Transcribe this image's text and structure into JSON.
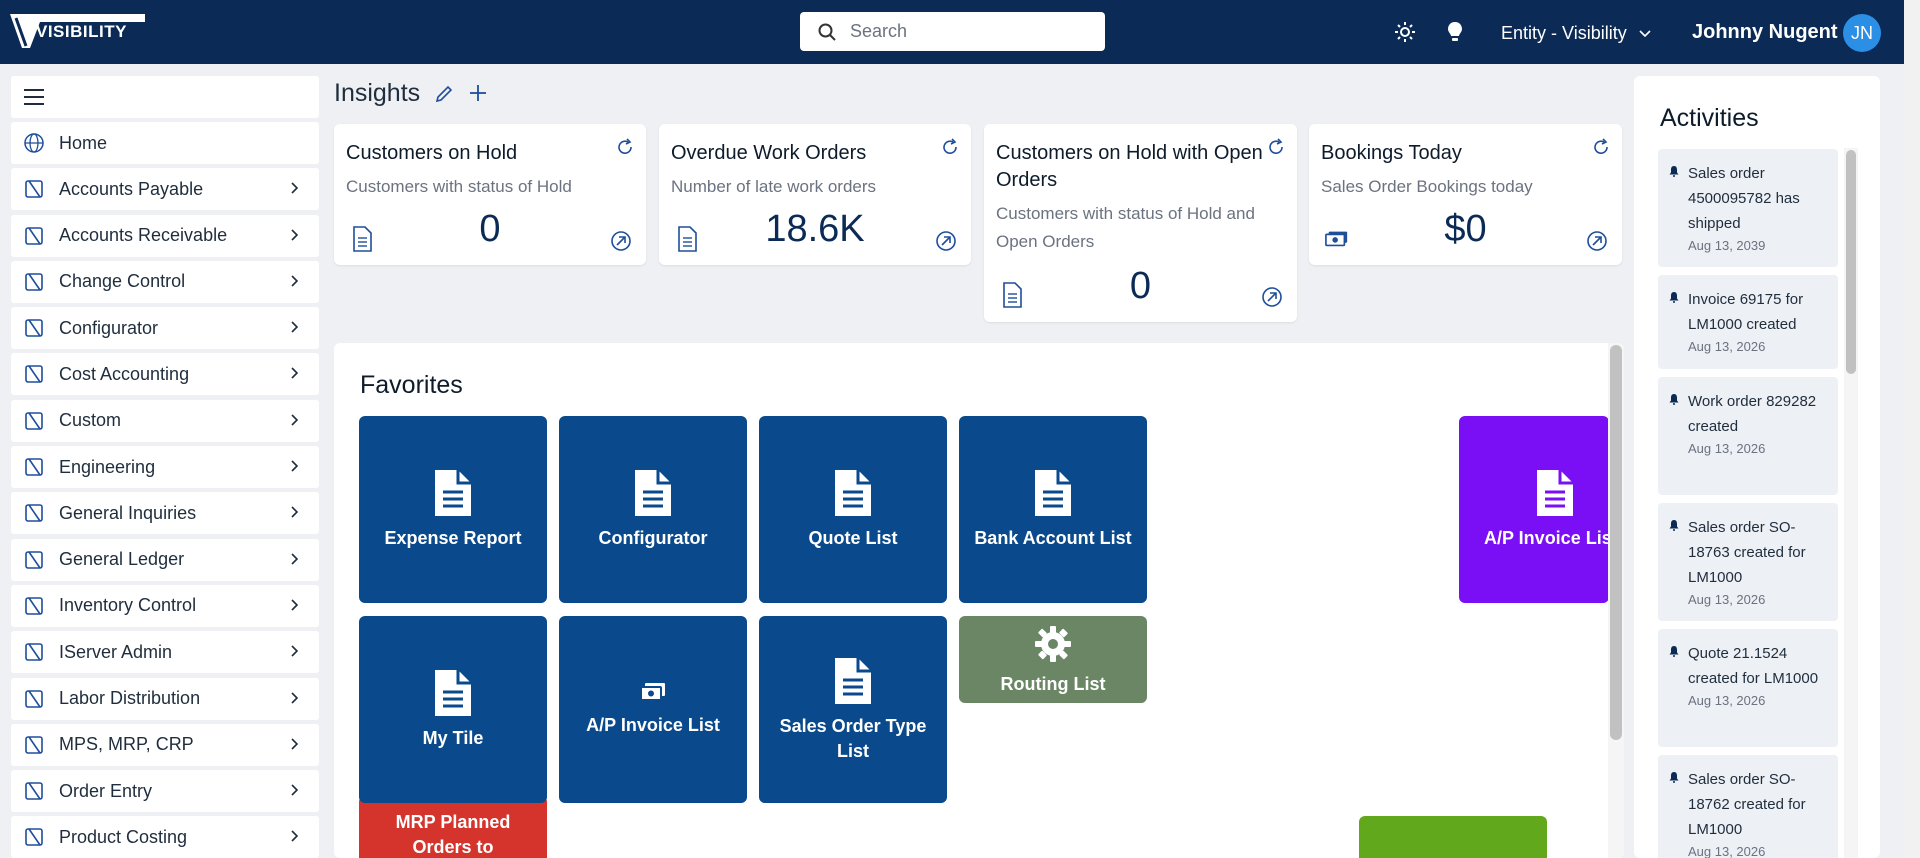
{
  "header": {
    "logo_text": "VISIBILITY",
    "search_placeholder": "Search",
    "entity_label": "Entity - Visibility",
    "user_name": "Johnny Nugent",
    "user_initials": "JN"
  },
  "sidebar": {
    "items": [
      {
        "label": "Home",
        "icon": "globe-icon"
      },
      {
        "label": "Accounts Payable",
        "icon": "module-icon"
      },
      {
        "label": "Accounts Receivable",
        "icon": "module-icon"
      },
      {
        "label": "Change Control",
        "icon": "module-icon"
      },
      {
        "label": "Configurator",
        "icon": "module-icon"
      },
      {
        "label": "Cost Accounting",
        "icon": "module-icon"
      },
      {
        "label": "Custom",
        "icon": "module-icon"
      },
      {
        "label": "Engineering",
        "icon": "module-icon"
      },
      {
        "label": "General Inquiries",
        "icon": "module-icon"
      },
      {
        "label": "General Ledger",
        "icon": "module-icon"
      },
      {
        "label": "Inventory Control",
        "icon": "module-icon"
      },
      {
        "label": "IServer Admin",
        "icon": "module-icon"
      },
      {
        "label": "Labor Distribution",
        "icon": "module-icon"
      },
      {
        "label": "MPS, MRP, CRP",
        "icon": "module-icon"
      },
      {
        "label": "Order Entry",
        "icon": "module-icon"
      },
      {
        "label": "Product Costing",
        "icon": "module-icon"
      }
    ]
  },
  "insights": {
    "title": "Insights",
    "cards": [
      {
        "title": "Customers on Hold",
        "subtitle": "Customers with status of Hold",
        "value": "0",
        "icon": "document-icon"
      },
      {
        "title": "Overdue Work Orders",
        "subtitle": "Number of late work orders",
        "value": "18.6K",
        "icon": "document-icon"
      },
      {
        "title": "Customers on Hold with Open Orders",
        "subtitle": "Customers with status of Hold and Open Orders",
        "value": "0",
        "icon": "document-icon"
      },
      {
        "title": "Bookings Today",
        "subtitle": "Sales Order Bookings today",
        "value": "$0",
        "icon": "money-icon"
      }
    ]
  },
  "favorites": {
    "title": "Favorites",
    "tiles": [
      {
        "label": "Expense Report",
        "color": "#0a4a8c",
        "icon": "document-icon"
      },
      {
        "label": "Configurator",
        "color": "#0a4a8c",
        "icon": "document-icon"
      },
      {
        "label": "Quote List",
        "color": "#0a4a8c",
        "icon": "document-icon"
      },
      {
        "label": "Bank Account List",
        "color": "#0a4a8c",
        "icon": "document-icon"
      },
      {
        "label": "A/P Invoice List",
        "color": "#7a0ff5",
        "icon": "document-icon"
      },
      {
        "label": "My Tile",
        "color": "#0a4a8c",
        "icon": "document-icon"
      },
      {
        "label": "A/P Invoice List",
        "color": "#0a4a8c",
        "icon": "money-icon"
      },
      {
        "label": "Sales Order Type List",
        "color": "#0a4a8c",
        "icon": "document-icon"
      },
      {
        "label": "Routing List",
        "color": "#6b8665",
        "icon": "gear-icon"
      },
      {
        "label": "MRP Planned Orders to Purchase Orders",
        "color": "#d4342c",
        "icon": "none"
      },
      {
        "label": "",
        "color": "#62a81c",
        "icon": "none"
      }
    ]
  },
  "activities": {
    "title": "Activities",
    "items": [
      {
        "text": "Sales order 4500095782 has shipped",
        "date": "Aug 13, 2039"
      },
      {
        "text": "Invoice 69175 for LM1000 created",
        "date": "Aug 13, 2026"
      },
      {
        "text": "Work order 829282 created",
        "date": "Aug 13, 2026"
      },
      {
        "text": "Sales order SO-18763 created for LM1000",
        "date": "Aug 13, 2026"
      },
      {
        "text": "Quote 21.1524 created for LM1000",
        "date": "Aug 13, 2026"
      },
      {
        "text": "Sales order SO-18762 created for LM1000",
        "date": "Aug 13, 2026"
      }
    ]
  },
  "colors": {
    "header": "#0b2a55",
    "accent": "#0a4a8c",
    "avatar": "#2b8fe6"
  }
}
